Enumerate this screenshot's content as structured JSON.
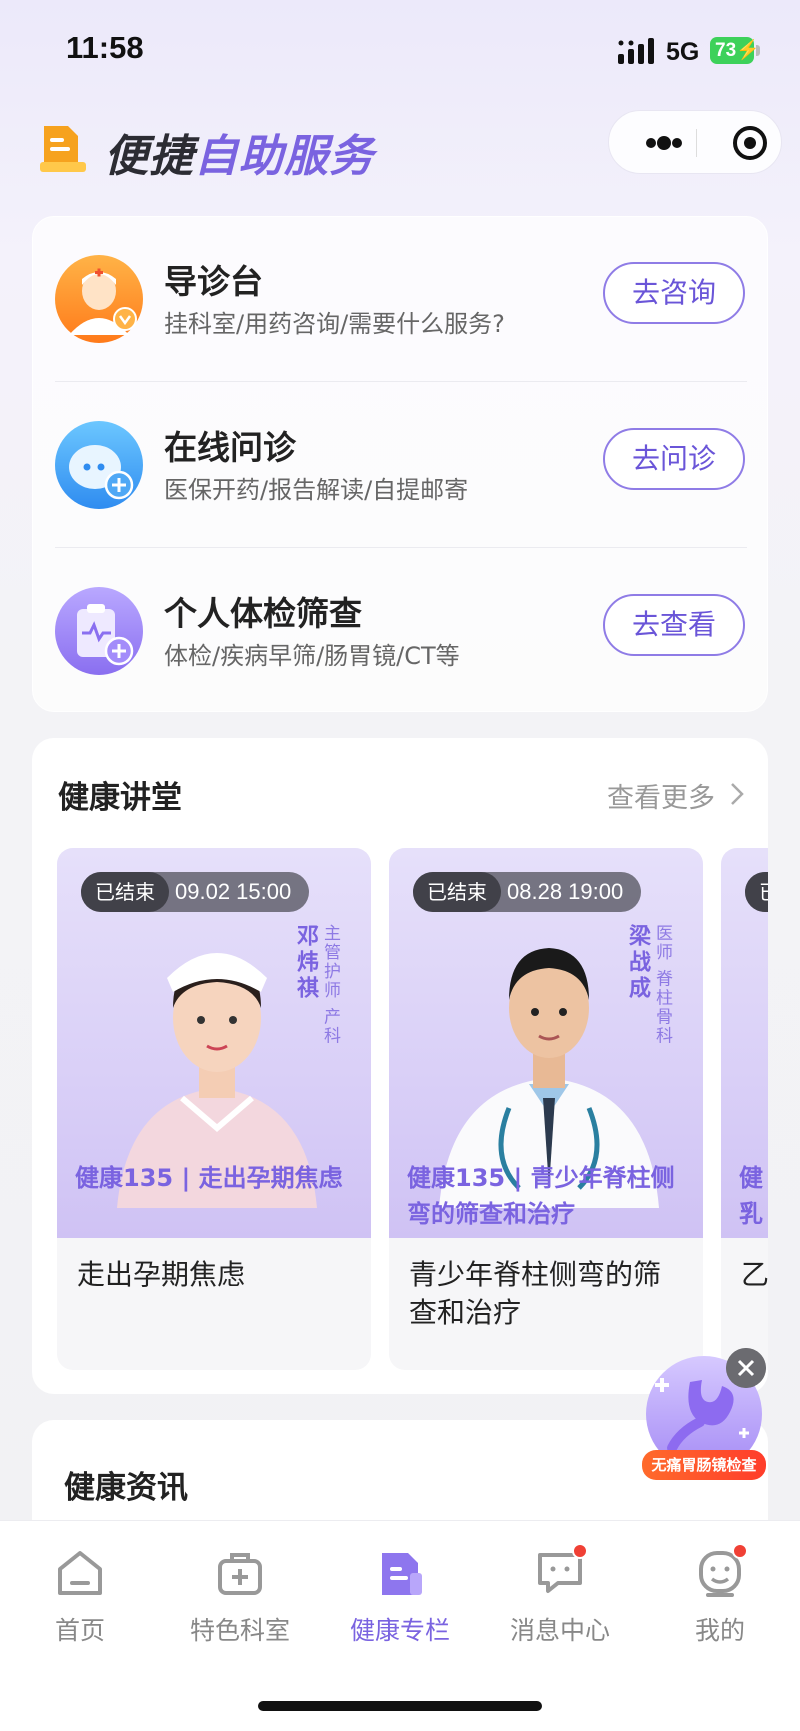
{
  "status_bar": {
    "time": "11:58",
    "network": "5G",
    "battery": "73"
  },
  "header": {
    "title_part1": "便捷",
    "title_part2": "自助服务",
    "menu_icon": "more-dots-icon",
    "target_icon": "target-icon"
  },
  "services": [
    {
      "title": "导诊台",
      "subtitle": "挂科室/用药咨询/需要什么服务?",
      "button": "去咨询",
      "icon": "doctor-avatar-icon"
    },
    {
      "title": "在线问诊",
      "subtitle": "医保开药/报告解读/自提邮寄",
      "button": "去问诊",
      "icon": "chat-bubble-icon"
    },
    {
      "title": "个人体检筛查",
      "subtitle": "体检/疾病早筛/肠胃镜/CT等",
      "button": "去查看",
      "icon": "clipboard-health-icon"
    }
  ],
  "lectures": {
    "title": "健康讲堂",
    "more": "查看更多",
    "items": [
      {
        "status": "已结束",
        "datetime": "09.02 15:00",
        "doctor": "邓炜祺",
        "role1": "主管护师",
        "role2": "产科",
        "poster_title": "健康135 | 走出孕期焦虑",
        "caption": "走出孕期焦虑"
      },
      {
        "status": "已结束",
        "datetime": "08.28 19:00",
        "doctor": "梁战成",
        "role1": "医师",
        "role2": "脊柱骨科",
        "poster_title": "健康135 | 青少年脊柱侧弯的筛查和治疗",
        "caption": "青少年脊柱侧弯的筛查和治疗"
      },
      {
        "status": "已",
        "poster_title": "健\n乳",
        "caption": "乙"
      }
    ]
  },
  "news": {
    "title": "健康资讯"
  },
  "promo": {
    "label": "无痛胃肠镜检查"
  },
  "tabbar": [
    {
      "label": "首页",
      "icon": "home-icon",
      "active": false,
      "badge": false
    },
    {
      "label": "特色科室",
      "icon": "medical-kit-icon",
      "active": false,
      "badge": false
    },
    {
      "label": "健康专栏",
      "icon": "health-column-icon",
      "active": true,
      "badge": false
    },
    {
      "label": "消息中心",
      "icon": "message-icon",
      "active": false,
      "badge": true
    },
    {
      "label": "我的",
      "icon": "profile-icon",
      "active": false,
      "badge": true
    }
  ],
  "colors": {
    "accent": "#7A63E0",
    "badge": "#F04035",
    "promo": "#FF4A2B"
  }
}
